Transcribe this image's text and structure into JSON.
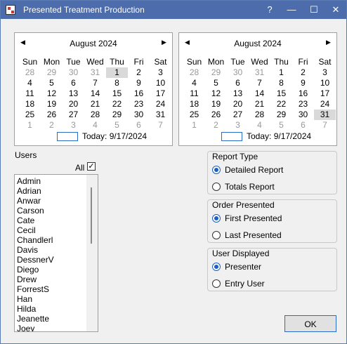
{
  "window": {
    "title": "Presented Treatment Production"
  },
  "titlebar_buttons": {
    "help": "?",
    "minimize": "—",
    "maximize": "☐",
    "close": "✕"
  },
  "calendar_left": {
    "month": "August 2024",
    "prev": "◀",
    "next": "▶",
    "weekdays": [
      "Sun",
      "Mon",
      "Tue",
      "Wed",
      "Thu",
      "Fri",
      "Sat"
    ],
    "weeks": [
      [
        "28",
        "29",
        "30",
        "31",
        "1",
        "2",
        "3"
      ],
      [
        "4",
        "5",
        "6",
        "7",
        "8",
        "9",
        "10"
      ],
      [
        "11",
        "12",
        "13",
        "14",
        "15",
        "16",
        "17"
      ],
      [
        "18",
        "19",
        "20",
        "21",
        "22",
        "23",
        "24"
      ],
      [
        "25",
        "26",
        "27",
        "28",
        "29",
        "30",
        "31"
      ],
      [
        "1",
        "2",
        "3",
        "4",
        "5",
        "6",
        "7"
      ]
    ],
    "today_text": "Today: 9/17/2024"
  },
  "calendar_right": {
    "month": "August 2024",
    "prev": "◀",
    "next": "▶",
    "weekdays": [
      "Sun",
      "Mon",
      "Tue",
      "Wed",
      "Thu",
      "Fri",
      "Sat"
    ],
    "weeks": [
      [
        "28",
        "29",
        "30",
        "31",
        "1",
        "2",
        "3"
      ],
      [
        "4",
        "5",
        "6",
        "7",
        "8",
        "9",
        "10"
      ],
      [
        "11",
        "12",
        "13",
        "14",
        "15",
        "16",
        "17"
      ],
      [
        "18",
        "19",
        "20",
        "21",
        "22",
        "23",
        "24"
      ],
      [
        "25",
        "26",
        "27",
        "28",
        "29",
        "30",
        "31"
      ],
      [
        "1",
        "2",
        "3",
        "4",
        "5",
        "6",
        "7"
      ]
    ],
    "today_text": "Today: 9/17/2024"
  },
  "users": {
    "label": "Users",
    "all_label": "All",
    "all_checked": "✓",
    "items": [
      "Admin",
      "Adrian",
      "Anwar",
      "Carson",
      "Cate",
      "Cecil",
      "Chandlerl",
      "Davis",
      "DessnerV",
      "Diego",
      "Drew",
      "ForrestS",
      "Han",
      "Hilda",
      "Jeanette",
      "Joey"
    ]
  },
  "report_type": {
    "title": "Report Type",
    "options": [
      "Detailed Report",
      "Totals Report"
    ],
    "selected": "Detailed Report"
  },
  "order_presented": {
    "title": "Order Presented",
    "options": [
      "First Presented",
      "Last Presented"
    ],
    "selected": "First Presented"
  },
  "user_displayed": {
    "title": "User Displayed",
    "options": [
      "Presenter",
      "Entry User"
    ],
    "selected": "Presenter"
  },
  "buttons": {
    "ok": "OK"
  },
  "colors": {
    "titlebar": "#4d6cab",
    "accent": "#1b5fc1",
    "selected_day": "#d9d9d9"
  }
}
